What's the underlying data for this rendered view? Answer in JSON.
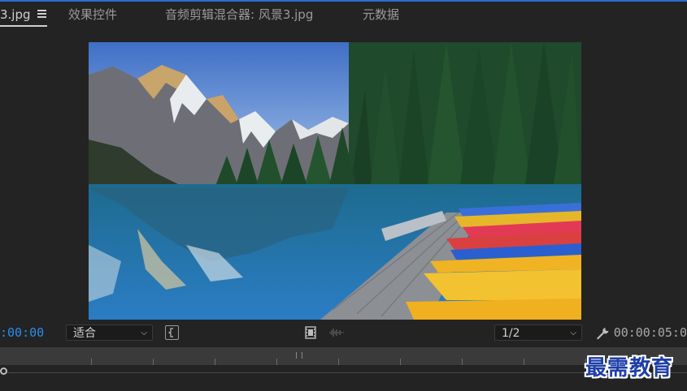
{
  "tabs": [
    {
      "label": "3.jpg",
      "active": true
    },
    {
      "label": "效果控件",
      "active": false
    },
    {
      "label": "音频剪辑混合器: 风景3.jpg",
      "active": false
    },
    {
      "label": "元数据",
      "active": false
    }
  ],
  "colors": {
    "accent": "#2d8ceb",
    "background": "#232323",
    "ruler": "#3a3a3a"
  },
  "controls": {
    "timecode_current": ":00:00",
    "fit_select": "适合",
    "resolution_select": "1/2",
    "timecode_duration": "00:00:05:0"
  },
  "icons": {
    "panel_menu": "hamburger-menu-icon",
    "marker": "add-marker-icon",
    "export_frame": "film-strip-icon",
    "audio_waveform": "audio-waveform-icon",
    "settings": "wrench-icon"
  },
  "preview": {
    "subject": "mountain lake landscape with canoes on dock"
  },
  "watermark": "最需教育"
}
